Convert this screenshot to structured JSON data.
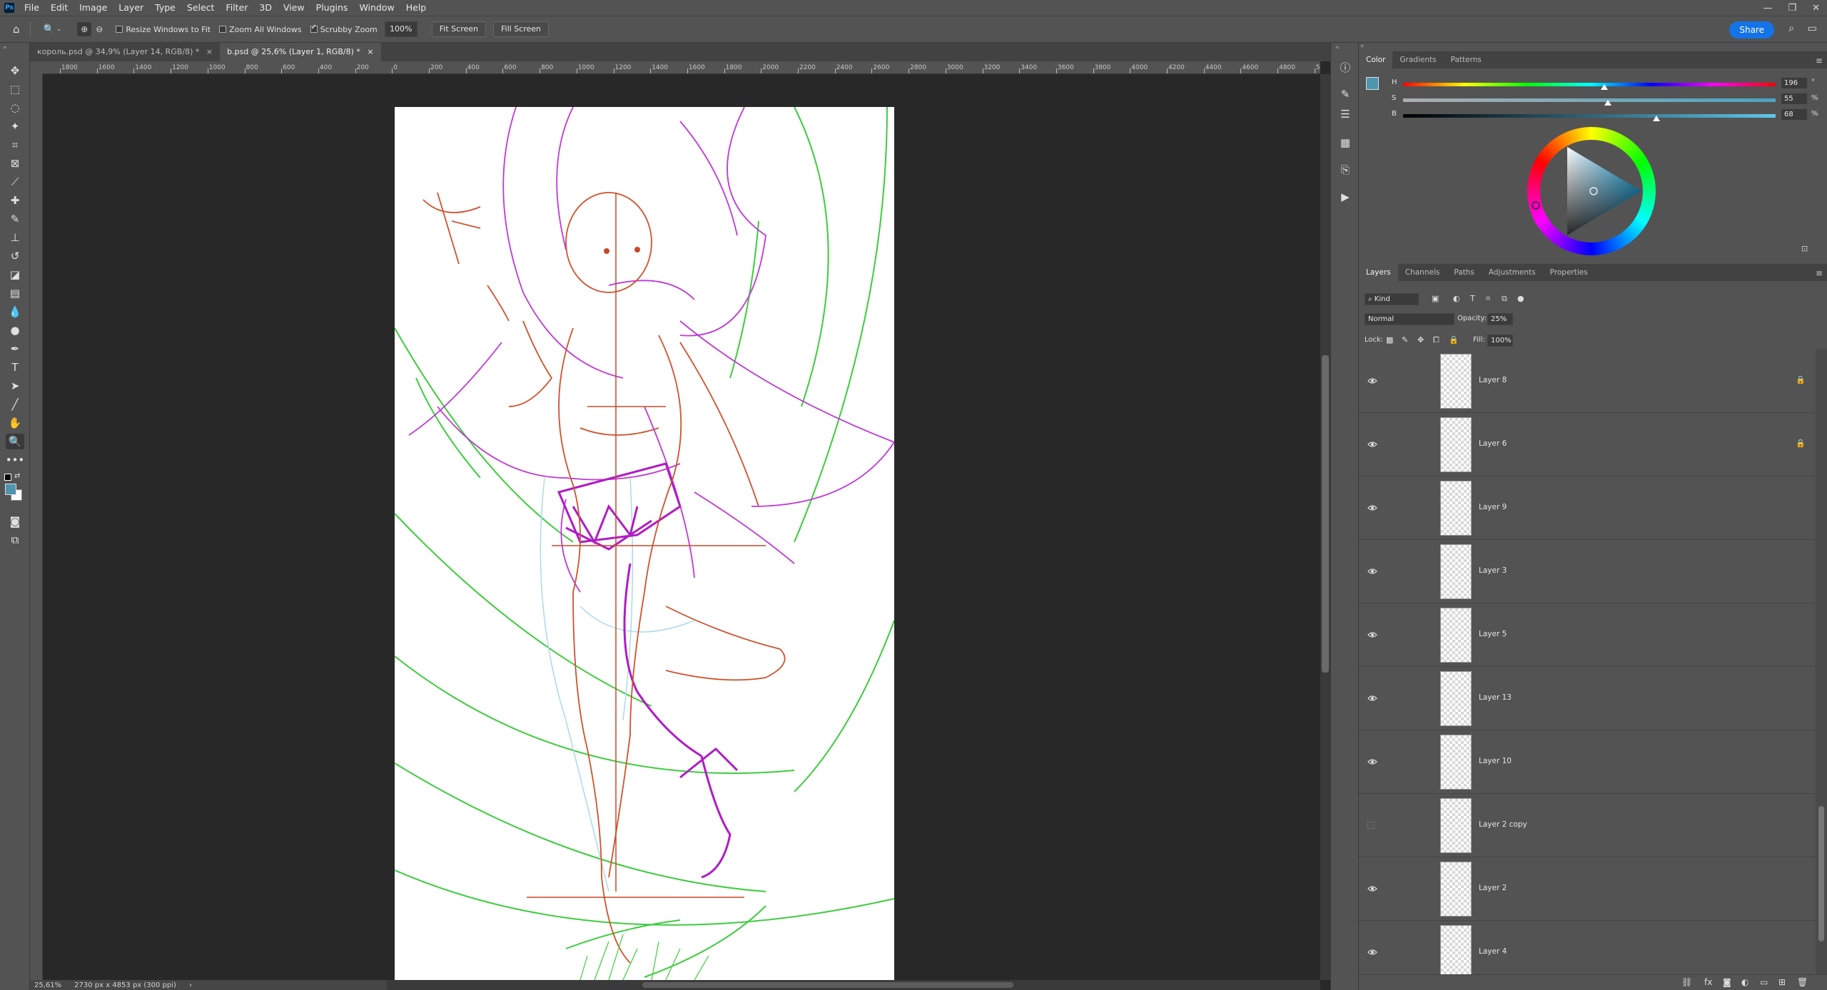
{
  "app": {
    "logo": "Ps"
  },
  "menu": [
    "File",
    "Edit",
    "Image",
    "Layer",
    "Type",
    "Select",
    "Filter",
    "3D",
    "View",
    "Plugins",
    "Window",
    "Help"
  ],
  "window_controls": {
    "minimize": "—",
    "restore": "❐",
    "close": "✕"
  },
  "options": {
    "resize_windows_label": "Resize Windows to Fit",
    "resize_windows_checked": false,
    "zoom_all_label": "Zoom All Windows",
    "zoom_all_checked": false,
    "scrubby_label": "Scrubby Zoom",
    "scrubby_checked": true,
    "zoom_value": "100%",
    "fit_screen": "Fit Screen",
    "fill_screen": "Fill Screen",
    "share": "Share"
  },
  "tabs": [
    {
      "label": "король.psd @ 34,9% (Layer 14, RGB/8) *",
      "close": "×",
      "active": false
    },
    {
      "label": "b.psd @ 25,6% (Layer 1, RGB/8) *",
      "close": "×",
      "active": true
    }
  ],
  "ruler": [
    "1800",
    "1600",
    "1400",
    "1200",
    "1000",
    "800",
    "600",
    "400",
    "200",
    "0",
    "200",
    "400",
    "600",
    "800",
    "1000",
    "1200",
    "1400",
    "1600",
    "1800",
    "2000",
    "2200",
    "2400",
    "2600",
    "2800",
    "3000",
    "3200",
    "3400",
    "3600",
    "3800",
    "4000",
    "4200",
    "4400",
    "4600",
    "4800",
    "50"
  ],
  "status": {
    "zoom": "25,61%",
    "dims": "2730 px x 4853 px (300 ppi)",
    "arrow": "›"
  },
  "color_panel": {
    "tabs": [
      "Color",
      "Gradients",
      "Patterns"
    ],
    "active_tab": "Color",
    "h": {
      "label": "H",
      "value": "196",
      "unit": "°",
      "level": 0.54
    },
    "s": {
      "label": "S",
      "value": "55",
      "unit": "%",
      "level": 0.55
    },
    "b": {
      "label": "B",
      "value": "68",
      "unit": "%",
      "level": 0.68
    },
    "foreground": "#4e95ad"
  },
  "layers_panel": {
    "tabs": [
      "Layers",
      "Channels",
      "Paths",
      "Adjustments",
      "Properties"
    ],
    "active_tab": "Layers",
    "kind": "Kind",
    "blend": "Normal",
    "opacity_label": "Opacity:",
    "opacity": "25%",
    "lock_label": "Lock:",
    "fill_label": "Fill:",
    "fill": "100%",
    "layers": [
      {
        "name": "Layer 8",
        "visible": true,
        "locked": true
      },
      {
        "name": "Layer 6",
        "visible": true,
        "locked": true
      },
      {
        "name": "Layer 9",
        "visible": true,
        "locked": false
      },
      {
        "name": "Layer 3",
        "visible": true,
        "locked": false
      },
      {
        "name": "Layer 5",
        "visible": true,
        "locked": false
      },
      {
        "name": "Layer 13",
        "visible": true,
        "locked": false
      },
      {
        "name": "Layer 10",
        "visible": true,
        "locked": false
      },
      {
        "name": "Layer 2 copy",
        "visible": false,
        "locked": false
      },
      {
        "name": "Layer 2",
        "visible": true,
        "locked": false
      },
      {
        "name": "Layer 4",
        "visible": true,
        "locked": false
      }
    ]
  },
  "icons": {
    "home": "⌂",
    "zoom": "🔍",
    "eye": "👁",
    "lock": "🔒",
    "menu": "≡",
    "info": "ⓘ",
    "play": "▶",
    "search": "⌕",
    "layout": "▭"
  }
}
